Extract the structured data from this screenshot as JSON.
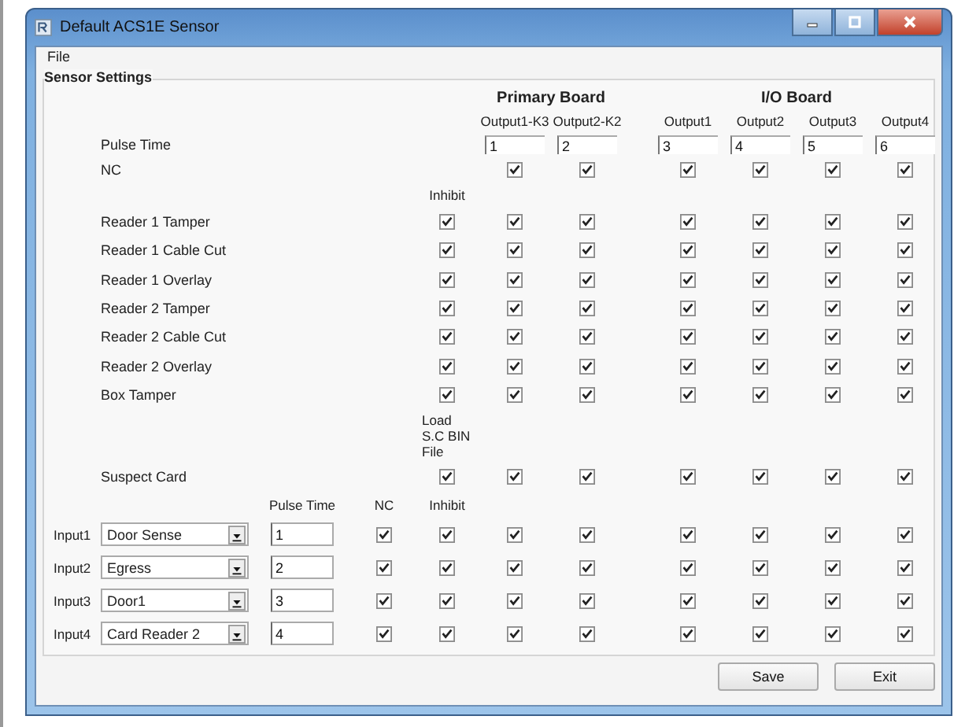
{
  "window": {
    "title": "Default ACS1E Sensor"
  },
  "menu": [
    "File"
  ],
  "group_title": "Sensor Settings",
  "boards": [
    "Primary Board",
    "I/O Board"
  ],
  "outputs": [
    {
      "label": "Output1-K3",
      "pulse_time": "1"
    },
    {
      "label": "Output2-K2",
      "pulse_time": "2"
    },
    {
      "label": "Output1",
      "pulse_time": "3"
    },
    {
      "label": "Output2",
      "pulse_time": "4"
    },
    {
      "label": "Output3",
      "pulse_time": "5"
    },
    {
      "label": "Output4",
      "pulse_time": "6"
    }
  ],
  "pulse_time_label": "Pulse Time",
  "nc_row": {
    "label": "NC",
    "checked": [
      true,
      true,
      true,
      true,
      true,
      true
    ]
  },
  "inhibit_header": "Inhibit",
  "sensors": [
    {
      "label": "Reader 1 Tamper",
      "inhibit": true,
      "checked": [
        true,
        true,
        true,
        true,
        true,
        true
      ]
    },
    {
      "label": "Reader 1 Cable Cut",
      "inhibit": true,
      "checked": [
        true,
        true,
        true,
        true,
        true,
        true
      ]
    },
    {
      "label": "Reader 1 Overlay",
      "inhibit": true,
      "checked": [
        true,
        true,
        true,
        true,
        true,
        true
      ]
    },
    {
      "label": "Reader 2 Tamper",
      "inhibit": true,
      "checked": [
        true,
        true,
        true,
        true,
        true,
        true
      ]
    },
    {
      "label": "Reader 2 Cable Cut",
      "inhibit": true,
      "checked": [
        true,
        true,
        true,
        true,
        true,
        true
      ]
    },
    {
      "label": "Reader 2 Overlay",
      "inhibit": true,
      "checked": [
        true,
        true,
        true,
        true,
        true,
        true
      ]
    },
    {
      "label": "Box Tamper",
      "inhibit": true,
      "checked": [
        true,
        true,
        true,
        true,
        true,
        true
      ]
    }
  ],
  "load_label": "Load S.C BIN File",
  "suspect": {
    "label": "Suspect Card",
    "load": true,
    "checked": [
      true,
      true,
      true,
      true,
      true,
      true
    ]
  },
  "input_headers": {
    "pulse_time": "Pulse Time",
    "nc": "NC",
    "inhibit": "Inhibit"
  },
  "inputs": [
    {
      "label": "Input1",
      "source": "Door Sense",
      "pulse_time": "1",
      "nc": true,
      "inhibit": true,
      "checked": [
        true,
        true,
        true,
        true,
        true,
        true
      ]
    },
    {
      "label": "Input2",
      "source": "Egress",
      "pulse_time": "2",
      "nc": true,
      "inhibit": true,
      "checked": [
        true,
        true,
        true,
        true,
        true,
        true
      ]
    },
    {
      "label": "Input3",
      "source": "Door1",
      "pulse_time": "3",
      "nc": true,
      "inhibit": true,
      "checked": [
        true,
        true,
        true,
        true,
        true,
        true
      ]
    },
    {
      "label": "Input4",
      "source": "Card Reader 2",
      "pulse_time": "4",
      "nc": true,
      "inhibit": true,
      "checked": [
        true,
        true,
        true,
        true,
        true,
        true
      ]
    }
  ],
  "buttons": [
    "Save",
    "Exit"
  ]
}
